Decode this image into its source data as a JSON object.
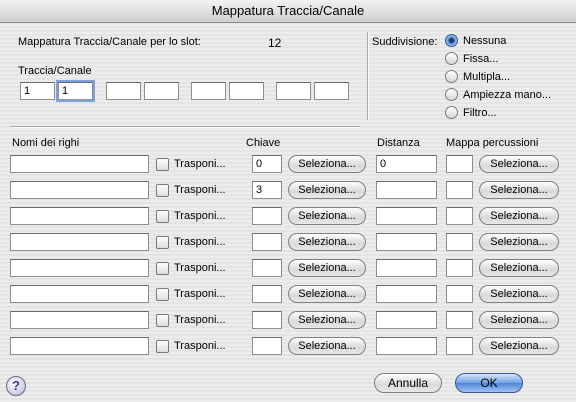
{
  "window": {
    "title": "Mappatura Traccia/Canale"
  },
  "header": {
    "slot_label": "Mappatura Traccia/Canale per lo slot:",
    "slot_value": "12",
    "traccia_canale_label": "Traccia/Canale",
    "traccia_canale_fields": [
      "1",
      "1",
      "",
      "",
      "",
      "",
      "",
      ""
    ]
  },
  "suddivisione": {
    "label": "Suddivisione:",
    "options": [
      "Nessuna",
      "Fissa...",
      "Multipla...",
      "Ampiezza mano...",
      "Filtro..."
    ],
    "selected": "Nessuna"
  },
  "columns": {
    "staff_names": "Nomi dei righi",
    "key": "Chiave",
    "distance": "Distanza",
    "percussion_map": "Mappa percussioni"
  },
  "rows": [
    {
      "name": "",
      "transpose_label": "Trasponi...",
      "key": "0",
      "select_label": "Seleziona...",
      "distance": "0",
      "percussion": "",
      "perc_select_label": "Seleziona..."
    },
    {
      "name": "",
      "transpose_label": "Trasponi...",
      "key": "3",
      "select_label": "Seleziona...",
      "distance": "",
      "percussion": "",
      "perc_select_label": "Seleziona..."
    },
    {
      "name": "",
      "transpose_label": "Trasponi...",
      "key": "",
      "select_label": "Seleziona...",
      "distance": "",
      "percussion": "",
      "perc_select_label": "Seleziona..."
    },
    {
      "name": "",
      "transpose_label": "Trasponi...",
      "key": "",
      "select_label": "Seleziona...",
      "distance": "",
      "percussion": "",
      "perc_select_label": "Seleziona..."
    },
    {
      "name": "",
      "transpose_label": "Trasponi...",
      "key": "",
      "select_label": "Seleziona...",
      "distance": "",
      "percussion": "",
      "perc_select_label": "Seleziona..."
    },
    {
      "name": "",
      "transpose_label": "Trasponi...",
      "key": "",
      "select_label": "Seleziona...",
      "distance": "",
      "percussion": "",
      "perc_select_label": "Seleziona..."
    },
    {
      "name": "",
      "transpose_label": "Trasponi...",
      "key": "",
      "select_label": "Seleziona...",
      "distance": "",
      "percussion": "",
      "perc_select_label": "Seleziona..."
    },
    {
      "name": "",
      "transpose_label": "Trasponi...",
      "key": "",
      "select_label": "Seleziona...",
      "distance": "",
      "percussion": "",
      "perc_select_label": "Seleziona..."
    }
  ],
  "footer": {
    "help_icon": "?",
    "cancel_label": "Annulla",
    "ok_label": "OK"
  }
}
